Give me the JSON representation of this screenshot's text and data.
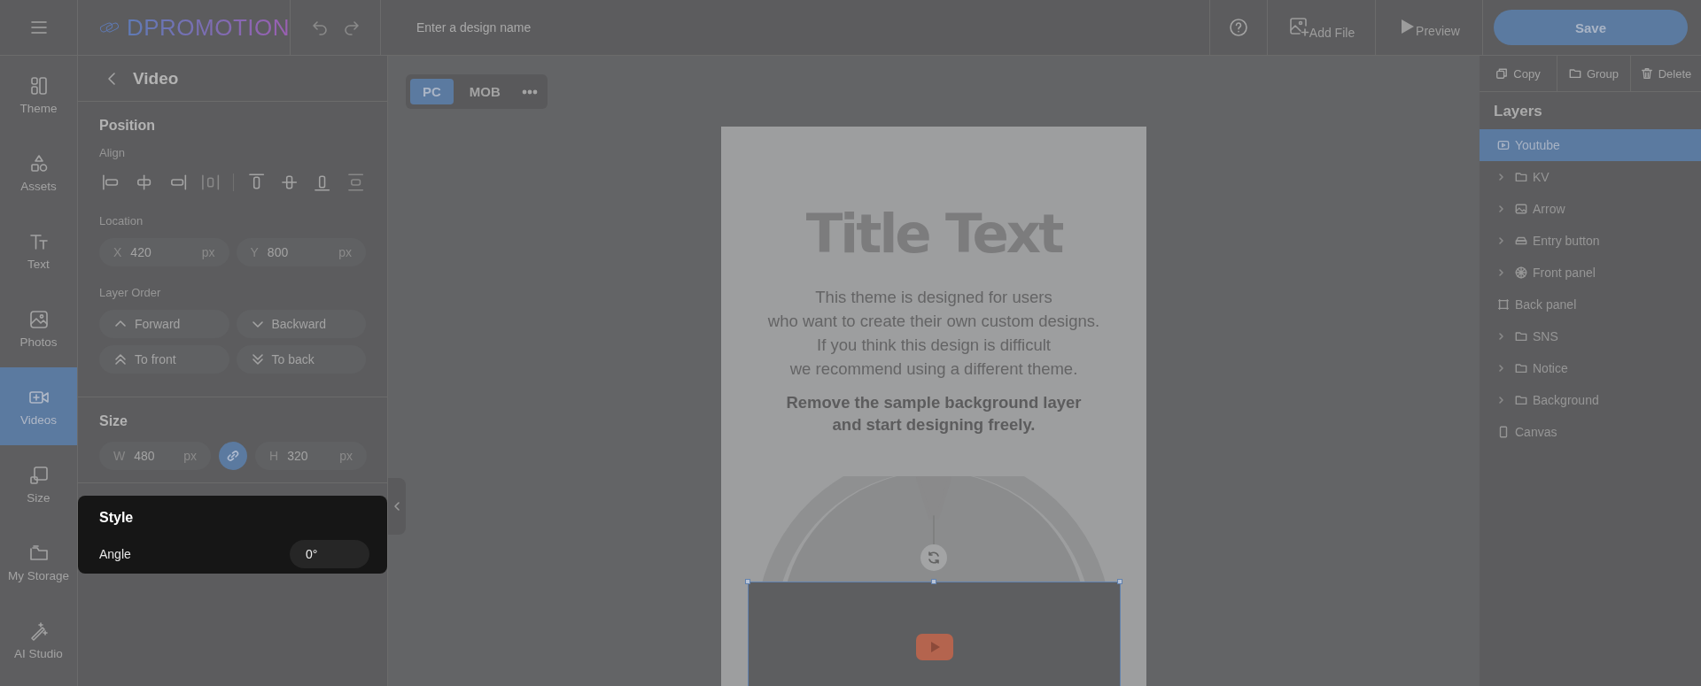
{
  "topbar": {
    "logo": "DPROMOTION",
    "design_name": {
      "placeholder": "Enter a design name"
    },
    "actions": [
      {
        "label": "Add File"
      },
      {
        "label": "Preview"
      }
    ],
    "save": "Save"
  },
  "rail": [
    {
      "label": "Theme",
      "selected": false
    },
    {
      "label": "Assets",
      "selected": false
    },
    {
      "label": "Text",
      "selected": false
    },
    {
      "label": "Photos",
      "selected": false
    },
    {
      "label": "Videos",
      "selected": true
    },
    {
      "label": "Size",
      "selected": false
    },
    {
      "label": "My Storage",
      "selected": false
    },
    {
      "label": "AI Studio",
      "selected": false
    }
  ],
  "panel": {
    "title": "Video",
    "position": {
      "heading": "Position",
      "align_label": "Align",
      "location_label": "Location",
      "location": [
        {
          "axis": "X",
          "value": "420",
          "unit": "px"
        },
        {
          "axis": "Y",
          "value": "800",
          "unit": "px"
        }
      ],
      "order_label": "Layer Order",
      "order_buttons": [
        "Forward",
        "Backward",
        "To front",
        "To back"
      ]
    },
    "size": {
      "heading": "Size",
      "fields": [
        {
          "axis": "W",
          "value": "480",
          "unit": "px"
        },
        {
          "axis": "H",
          "value": "320",
          "unit": "px"
        }
      ],
      "ratio_locked": true
    },
    "style": {
      "heading": "Style",
      "angle_label": "Angle",
      "angle": "0°"
    }
  },
  "view_tabs": [
    {
      "label": "PC",
      "selected": true
    },
    {
      "label": "MOB",
      "selected": false
    }
  ],
  "artboard": {
    "title": "Title Text",
    "body": [
      "This theme is designed for users",
      "who want to create their own custom designs.",
      "If you think this design is difficult",
      "we recommend using a different theme."
    ],
    "emphasis": [
      "Remove the sample background layer",
      "and start designing freely."
    ]
  },
  "toolbar": [
    "Copy",
    "Group",
    "Delete"
  ],
  "layers": {
    "heading": "Layers",
    "items": [
      {
        "name": "Youtube",
        "kind": "video",
        "selected": true
      },
      {
        "name": "KV",
        "kind": "folder",
        "selected": false,
        "expanded": false
      },
      {
        "name": "Arrow",
        "kind": "image",
        "selected": false,
        "expanded": false
      },
      {
        "name": "Entry button",
        "kind": "button",
        "selected": false,
        "expanded": false
      },
      {
        "name": "Front panel",
        "kind": "component",
        "selected": false,
        "expanded": false
      },
      {
        "name": "Back panel",
        "kind": "frame",
        "selected": false
      },
      {
        "name": "SNS",
        "kind": "folder",
        "selected": false,
        "expanded": false
      },
      {
        "name": "Notice",
        "kind": "folder",
        "selected": false,
        "expanded": false
      },
      {
        "name": "Background",
        "kind": "folder",
        "selected": false,
        "expanded": false
      },
      {
        "name": "Canvas",
        "kind": "canvas",
        "selected": false
      }
    ]
  }
}
